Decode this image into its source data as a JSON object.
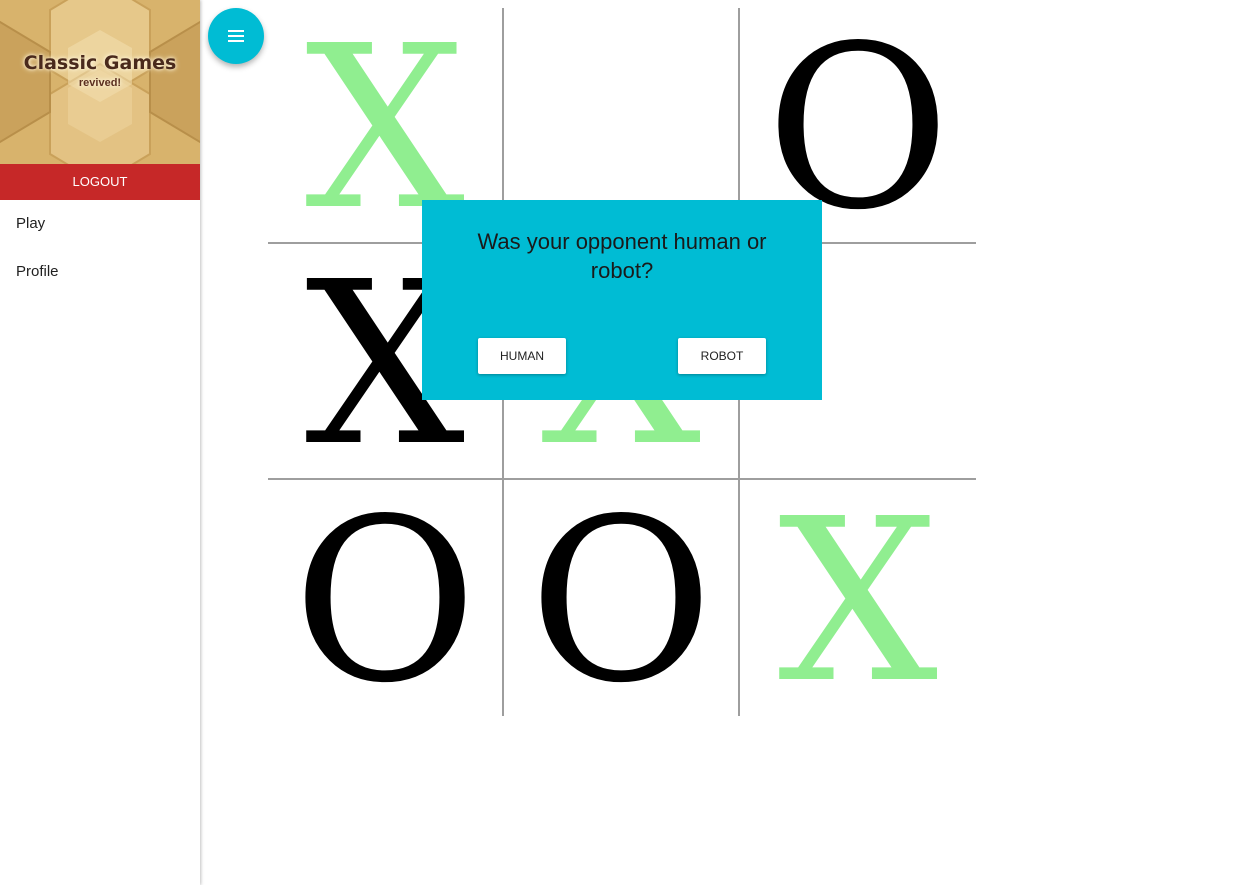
{
  "sidebar": {
    "banner": {
      "title": "Classic Games",
      "subtitle": "revived!"
    },
    "logout_label": "LOGOUT",
    "items": [
      {
        "label": "Play"
      },
      {
        "label": "Profile"
      }
    ]
  },
  "fab": {
    "icon": "menu-icon"
  },
  "board": {
    "cells": [
      {
        "mark": "X",
        "color": "#90ee90"
      },
      {
        "mark": "",
        "color": "#000000"
      },
      {
        "mark": "O",
        "color": "#000000"
      },
      {
        "mark": "X",
        "color": "#000000"
      },
      {
        "mark": "X",
        "color": "#90ee90"
      },
      {
        "mark": "",
        "color": "#000000"
      },
      {
        "mark": "O",
        "color": "#000000"
      },
      {
        "mark": "O",
        "color": "#000000"
      },
      {
        "mark": "X",
        "color": "#90ee90"
      }
    ]
  },
  "dialog": {
    "question": "Was your opponent human or robot?",
    "human_label": "HUMAN",
    "robot_label": "ROBOT"
  },
  "colors": {
    "accent": "#00bcd4",
    "logout": "#c62828",
    "winning_mark": "#90ee90",
    "grid_line": "#9e9e9e"
  }
}
